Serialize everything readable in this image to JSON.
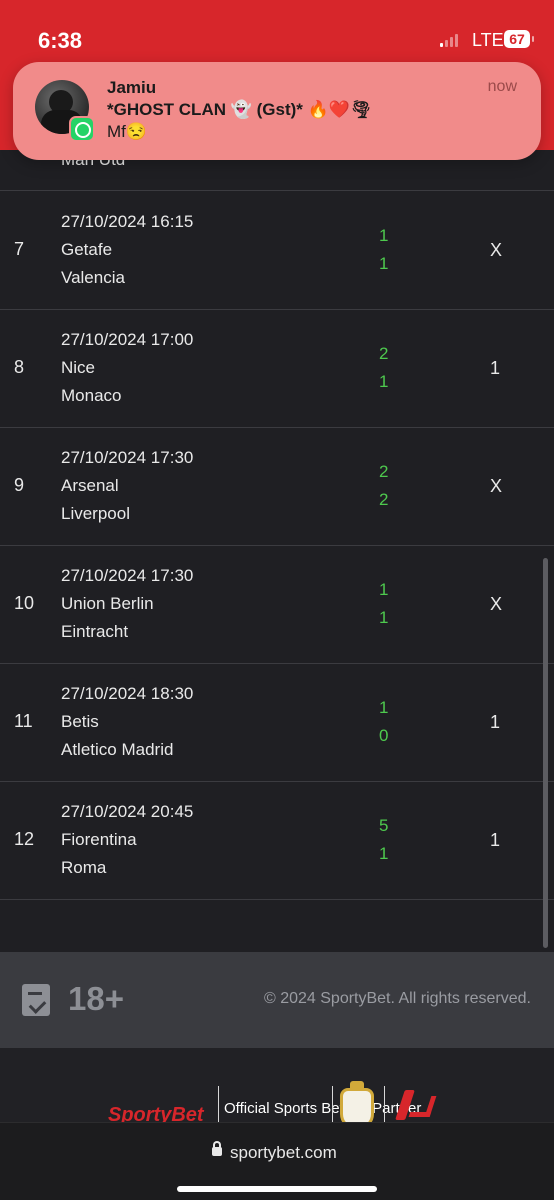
{
  "status_bar": {
    "time": "6:38",
    "network": "LTE",
    "battery": "67"
  },
  "notification": {
    "sender": "Jamiu",
    "group": "*GHOST CLAN 👻 (Gst)* 🔥❤️🌪",
    "message": "Mf😒",
    "time": "now",
    "app_icon": "whatsapp-business-icon"
  },
  "partial_row": {
    "away": "Man Utd"
  },
  "matches": [
    {
      "num": "7",
      "datetime": "27/10/2024 16:15",
      "home": "Getafe",
      "away": "Valencia",
      "home_score": "1",
      "away_score": "1",
      "pick": "X"
    },
    {
      "num": "8",
      "datetime": "27/10/2024 17:00",
      "home": "Nice",
      "away": "Monaco",
      "home_score": "2",
      "away_score": "1",
      "pick": "1"
    },
    {
      "num": "9",
      "datetime": "27/10/2024 17:30",
      "home": "Arsenal",
      "away": "Liverpool",
      "home_score": "2",
      "away_score": "2",
      "pick": "X"
    },
    {
      "num": "10",
      "datetime": "27/10/2024 17:30",
      "home": "Union Berlin",
      "away": "Eintracht",
      "home_score": "1",
      "away_score": "1",
      "pick": "X"
    },
    {
      "num": "11",
      "datetime": "27/10/2024 18:30",
      "home": "Betis",
      "away": "Atletico Madrid",
      "home_score": "1",
      "away_score": "0",
      "pick": "1"
    },
    {
      "num": "12",
      "datetime": "27/10/2024 20:45",
      "home": "Fiorentina",
      "away": "Roma",
      "home_score": "5",
      "away_score": "1",
      "pick": "1"
    }
  ],
  "footer": {
    "age_label": "18+",
    "copyright": "© 2024 SportyBet. All rights reserved."
  },
  "partners": {
    "brand": "SportyBet",
    "partner_text": "Official Sports Betting Partner"
  },
  "browser": {
    "url": "sportybet.com"
  },
  "colors": {
    "brand_red": "#d7262b",
    "score_green": "#4ec94e",
    "background": "#1f1f23"
  }
}
